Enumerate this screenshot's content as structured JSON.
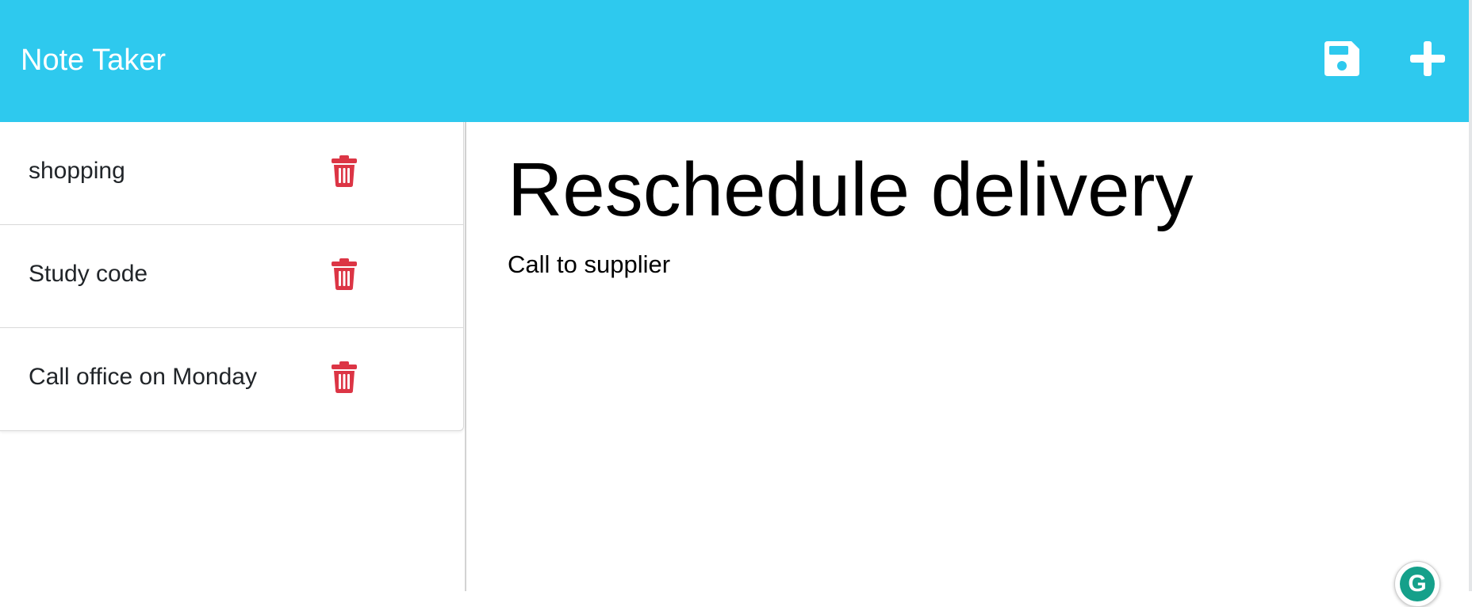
{
  "app": {
    "title": "Note Taker",
    "accent_color": "#2ec9ee",
    "danger_color": "#dc3545"
  },
  "toolbar": {
    "save_icon": "save-icon",
    "new_icon": "plus-icon"
  },
  "notes": [
    {
      "title": "shopping",
      "delete_icon": "trash-icon"
    },
    {
      "title": "Study code",
      "delete_icon": "trash-icon"
    },
    {
      "title": "Call office on Monday",
      "delete_icon": "trash-icon"
    }
  ],
  "active_note": {
    "title": "Reschedule delivery",
    "text": "Call to supplier"
  },
  "extension": {
    "badge_letter": "G",
    "badge_icon": "grammarly-icon"
  }
}
